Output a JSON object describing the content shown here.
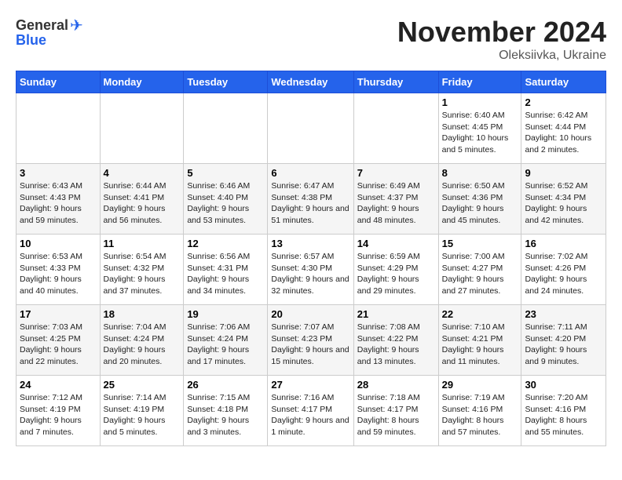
{
  "header": {
    "logo_general": "General",
    "logo_blue": "Blue",
    "month": "November 2024",
    "location": "Oleksiivka, Ukraine"
  },
  "weekdays": [
    "Sunday",
    "Monday",
    "Tuesday",
    "Wednesday",
    "Thursday",
    "Friday",
    "Saturday"
  ],
  "weeks": [
    [
      {
        "day": "",
        "info": ""
      },
      {
        "day": "",
        "info": ""
      },
      {
        "day": "",
        "info": ""
      },
      {
        "day": "",
        "info": ""
      },
      {
        "day": "",
        "info": ""
      },
      {
        "day": "1",
        "info": "Sunrise: 6:40 AM\nSunset: 4:45 PM\nDaylight: 10 hours and 5 minutes."
      },
      {
        "day": "2",
        "info": "Sunrise: 6:42 AM\nSunset: 4:44 PM\nDaylight: 10 hours and 2 minutes."
      }
    ],
    [
      {
        "day": "3",
        "info": "Sunrise: 6:43 AM\nSunset: 4:43 PM\nDaylight: 9 hours and 59 minutes."
      },
      {
        "day": "4",
        "info": "Sunrise: 6:44 AM\nSunset: 4:41 PM\nDaylight: 9 hours and 56 minutes."
      },
      {
        "day": "5",
        "info": "Sunrise: 6:46 AM\nSunset: 4:40 PM\nDaylight: 9 hours and 53 minutes."
      },
      {
        "day": "6",
        "info": "Sunrise: 6:47 AM\nSunset: 4:38 PM\nDaylight: 9 hours and 51 minutes."
      },
      {
        "day": "7",
        "info": "Sunrise: 6:49 AM\nSunset: 4:37 PM\nDaylight: 9 hours and 48 minutes."
      },
      {
        "day": "8",
        "info": "Sunrise: 6:50 AM\nSunset: 4:36 PM\nDaylight: 9 hours and 45 minutes."
      },
      {
        "day": "9",
        "info": "Sunrise: 6:52 AM\nSunset: 4:34 PM\nDaylight: 9 hours and 42 minutes."
      }
    ],
    [
      {
        "day": "10",
        "info": "Sunrise: 6:53 AM\nSunset: 4:33 PM\nDaylight: 9 hours and 40 minutes."
      },
      {
        "day": "11",
        "info": "Sunrise: 6:54 AM\nSunset: 4:32 PM\nDaylight: 9 hours and 37 minutes."
      },
      {
        "day": "12",
        "info": "Sunrise: 6:56 AM\nSunset: 4:31 PM\nDaylight: 9 hours and 34 minutes."
      },
      {
        "day": "13",
        "info": "Sunrise: 6:57 AM\nSunset: 4:30 PM\nDaylight: 9 hours and 32 minutes."
      },
      {
        "day": "14",
        "info": "Sunrise: 6:59 AM\nSunset: 4:29 PM\nDaylight: 9 hours and 29 minutes."
      },
      {
        "day": "15",
        "info": "Sunrise: 7:00 AM\nSunset: 4:27 PM\nDaylight: 9 hours and 27 minutes."
      },
      {
        "day": "16",
        "info": "Sunrise: 7:02 AM\nSunset: 4:26 PM\nDaylight: 9 hours and 24 minutes."
      }
    ],
    [
      {
        "day": "17",
        "info": "Sunrise: 7:03 AM\nSunset: 4:25 PM\nDaylight: 9 hours and 22 minutes."
      },
      {
        "day": "18",
        "info": "Sunrise: 7:04 AM\nSunset: 4:24 PM\nDaylight: 9 hours and 20 minutes."
      },
      {
        "day": "19",
        "info": "Sunrise: 7:06 AM\nSunset: 4:24 PM\nDaylight: 9 hours and 17 minutes."
      },
      {
        "day": "20",
        "info": "Sunrise: 7:07 AM\nSunset: 4:23 PM\nDaylight: 9 hours and 15 minutes."
      },
      {
        "day": "21",
        "info": "Sunrise: 7:08 AM\nSunset: 4:22 PM\nDaylight: 9 hours and 13 minutes."
      },
      {
        "day": "22",
        "info": "Sunrise: 7:10 AM\nSunset: 4:21 PM\nDaylight: 9 hours and 11 minutes."
      },
      {
        "day": "23",
        "info": "Sunrise: 7:11 AM\nSunset: 4:20 PM\nDaylight: 9 hours and 9 minutes."
      }
    ],
    [
      {
        "day": "24",
        "info": "Sunrise: 7:12 AM\nSunset: 4:19 PM\nDaylight: 9 hours and 7 minutes."
      },
      {
        "day": "25",
        "info": "Sunrise: 7:14 AM\nSunset: 4:19 PM\nDaylight: 9 hours and 5 minutes."
      },
      {
        "day": "26",
        "info": "Sunrise: 7:15 AM\nSunset: 4:18 PM\nDaylight: 9 hours and 3 minutes."
      },
      {
        "day": "27",
        "info": "Sunrise: 7:16 AM\nSunset: 4:17 PM\nDaylight: 9 hours and 1 minute."
      },
      {
        "day": "28",
        "info": "Sunrise: 7:18 AM\nSunset: 4:17 PM\nDaylight: 8 hours and 59 minutes."
      },
      {
        "day": "29",
        "info": "Sunrise: 7:19 AM\nSunset: 4:16 PM\nDaylight: 8 hours and 57 minutes."
      },
      {
        "day": "30",
        "info": "Sunrise: 7:20 AM\nSunset: 4:16 PM\nDaylight: 8 hours and 55 minutes."
      }
    ]
  ]
}
